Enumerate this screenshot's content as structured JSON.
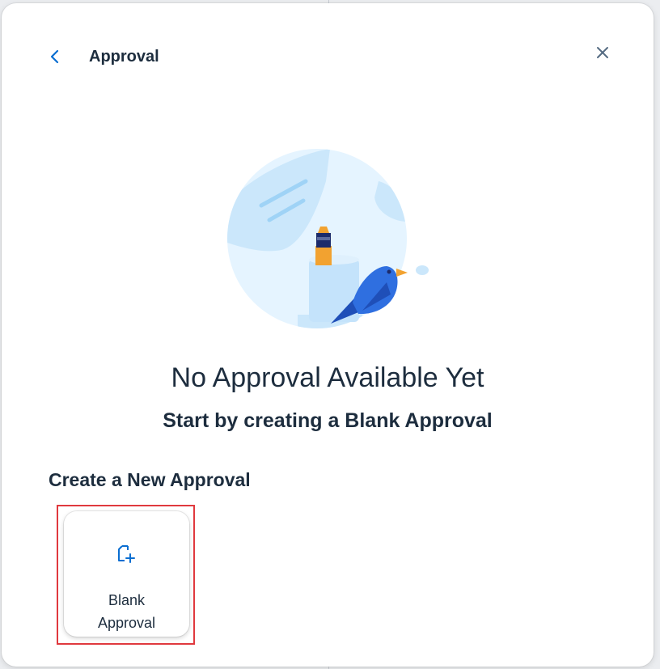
{
  "header": {
    "title": "Approval",
    "back_icon": "chevron-left-icon",
    "close_icon": "close-icon"
  },
  "empty_state": {
    "illustration": "empty-state-bird-illustration",
    "title": "No Approval Available Yet",
    "subtitle": "Start by creating a Blank Approval"
  },
  "create_section": {
    "title": "Create a New Approval",
    "cards": [
      {
        "label": "Blank\nApproval",
        "icon": "new-document-icon"
      }
    ]
  },
  "colors": {
    "accent": "#0a6ed1",
    "text": "#1d2d3e",
    "highlight": "#e0393e",
    "illustration_bg": "#e5f4ff",
    "bird": "#2f6fe0",
    "marker": "#f2a230"
  }
}
